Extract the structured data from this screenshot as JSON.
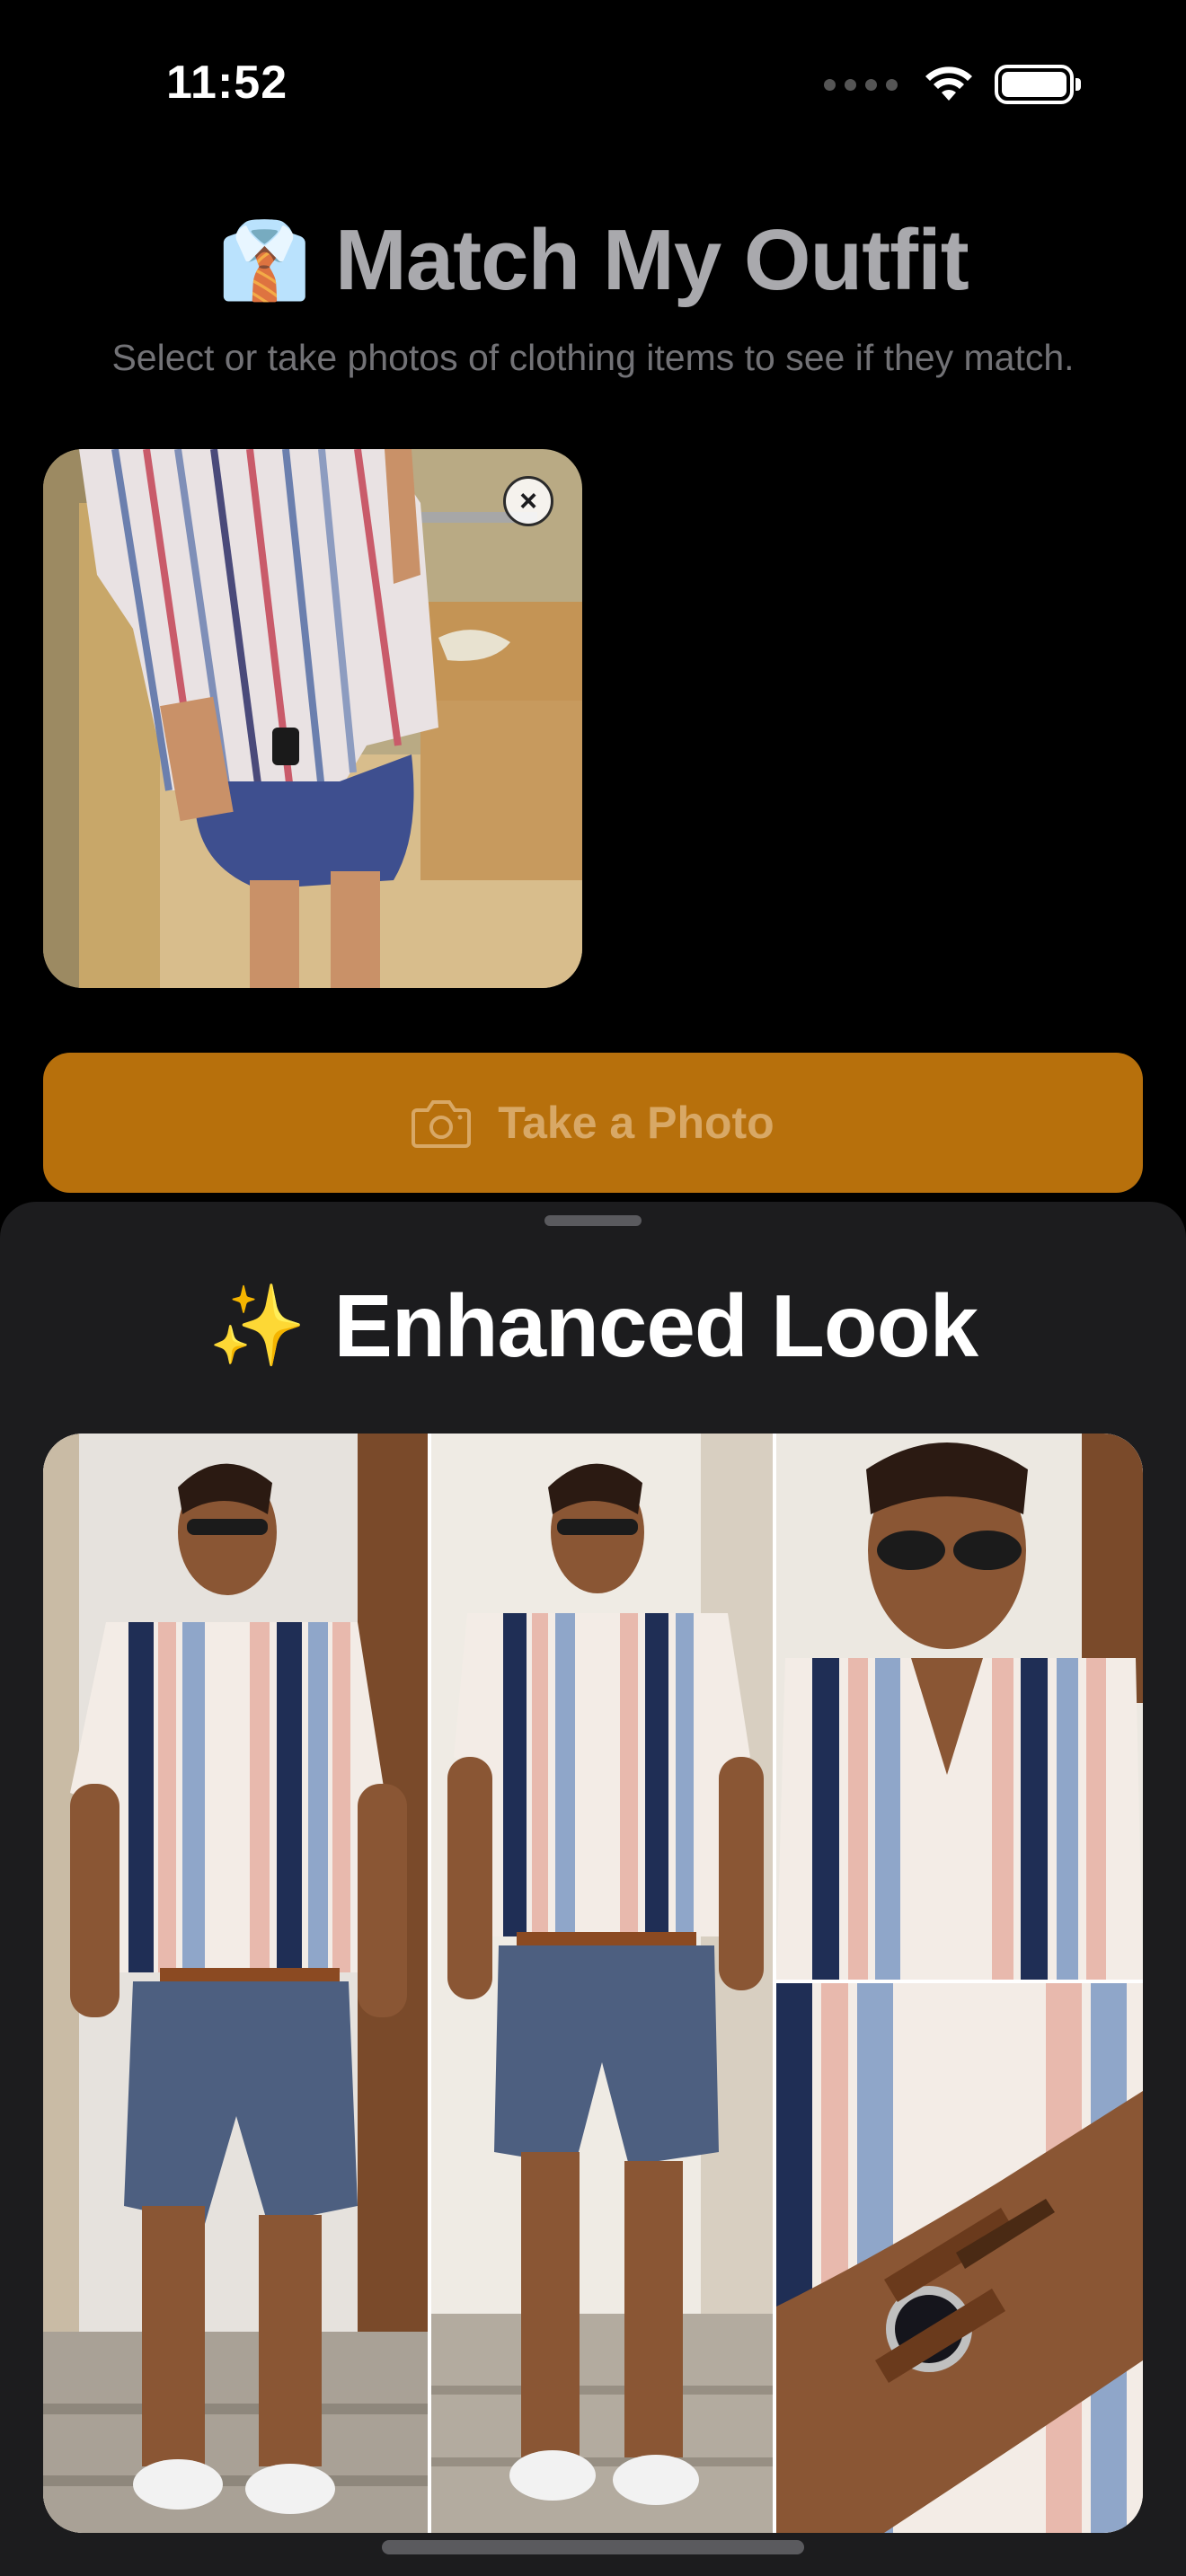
{
  "status_bar": {
    "time": "11:52"
  },
  "header": {
    "emoji": "👔",
    "title": "Match My Outfit",
    "subtitle": "Select or take photos of clothing items to see if they match."
  },
  "selected_photos": [
    {
      "remove_label": "×"
    }
  ],
  "take_photo_button": {
    "label": "Take a Photo"
  },
  "result_sheet": {
    "emoji": "✨",
    "title": "Enhanced Look"
  },
  "colors": {
    "accent": "#b7700c",
    "background": "#000000",
    "sheet": "#1c1c1e"
  }
}
